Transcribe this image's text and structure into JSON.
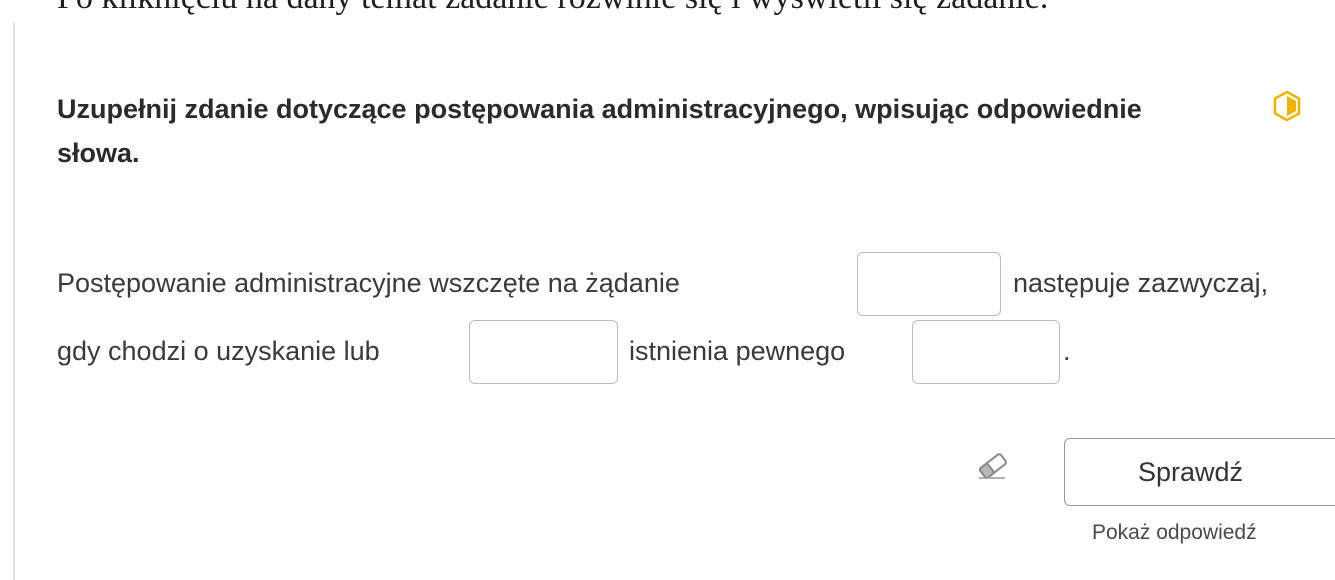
{
  "intro_text": "Po kliknięciu na dany temat zadanie rozwinie się i wyświetli się zadanie.",
  "task": {
    "title": "Uzupełnij zdanie dotyczące postępowania administracyjnego, wpisując odpowiednie słowa.",
    "level_icon": "half-filled-hexagon-icon",
    "accent_color": "#f0b400",
    "sentence": {
      "part1": "Postępowanie administracyjne wszczęte na żądanie",
      "part2": "następuje zazwyczaj,",
      "part3": "gdy chodzi o uzyskanie lub",
      "part4": "istnienia pewnego",
      "part5": "."
    },
    "gaps": [
      {
        "value": "",
        "placeholder": ""
      },
      {
        "value": "",
        "placeholder": ""
      },
      {
        "value": "",
        "placeholder": ""
      }
    ]
  },
  "actions": {
    "clear_icon": "eraser-icon",
    "check_label": "Sprawdź",
    "show_answer_label": "Pokaż odpowiedź"
  }
}
